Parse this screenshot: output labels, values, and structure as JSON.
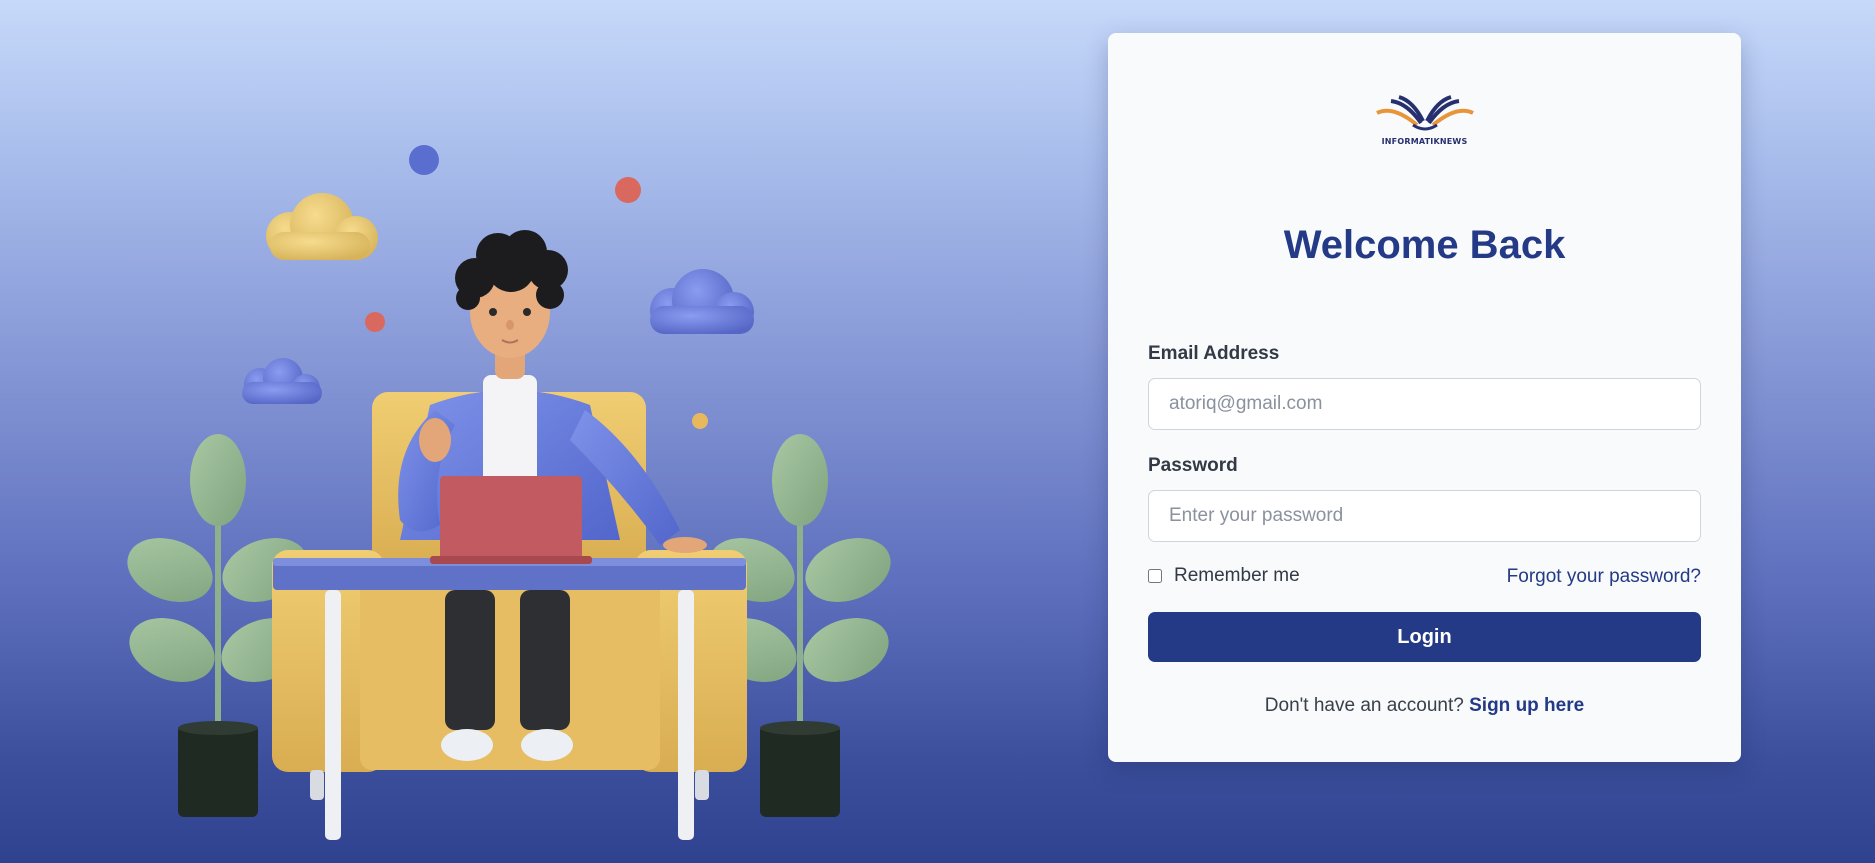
{
  "brand": {
    "logo_text": "INFORMATIKNEWS",
    "colors": {
      "primary": "#243a86",
      "accent": "#e8953a"
    }
  },
  "login_form": {
    "title": "Welcome Back",
    "email": {
      "label": "Email Address",
      "placeholder": "atoriq@gmail.com",
      "value": ""
    },
    "password": {
      "label": "Password",
      "placeholder": "Enter your password",
      "value": ""
    },
    "remember_label": "Remember me",
    "remember_checked": false,
    "forgot_label": "Forgot your password?",
    "submit_label": "Login",
    "signup_prompt": "Don't have an account?",
    "signup_link": "Sign up here"
  },
  "illustration": {
    "icon": "person-at-desk-illustration"
  }
}
